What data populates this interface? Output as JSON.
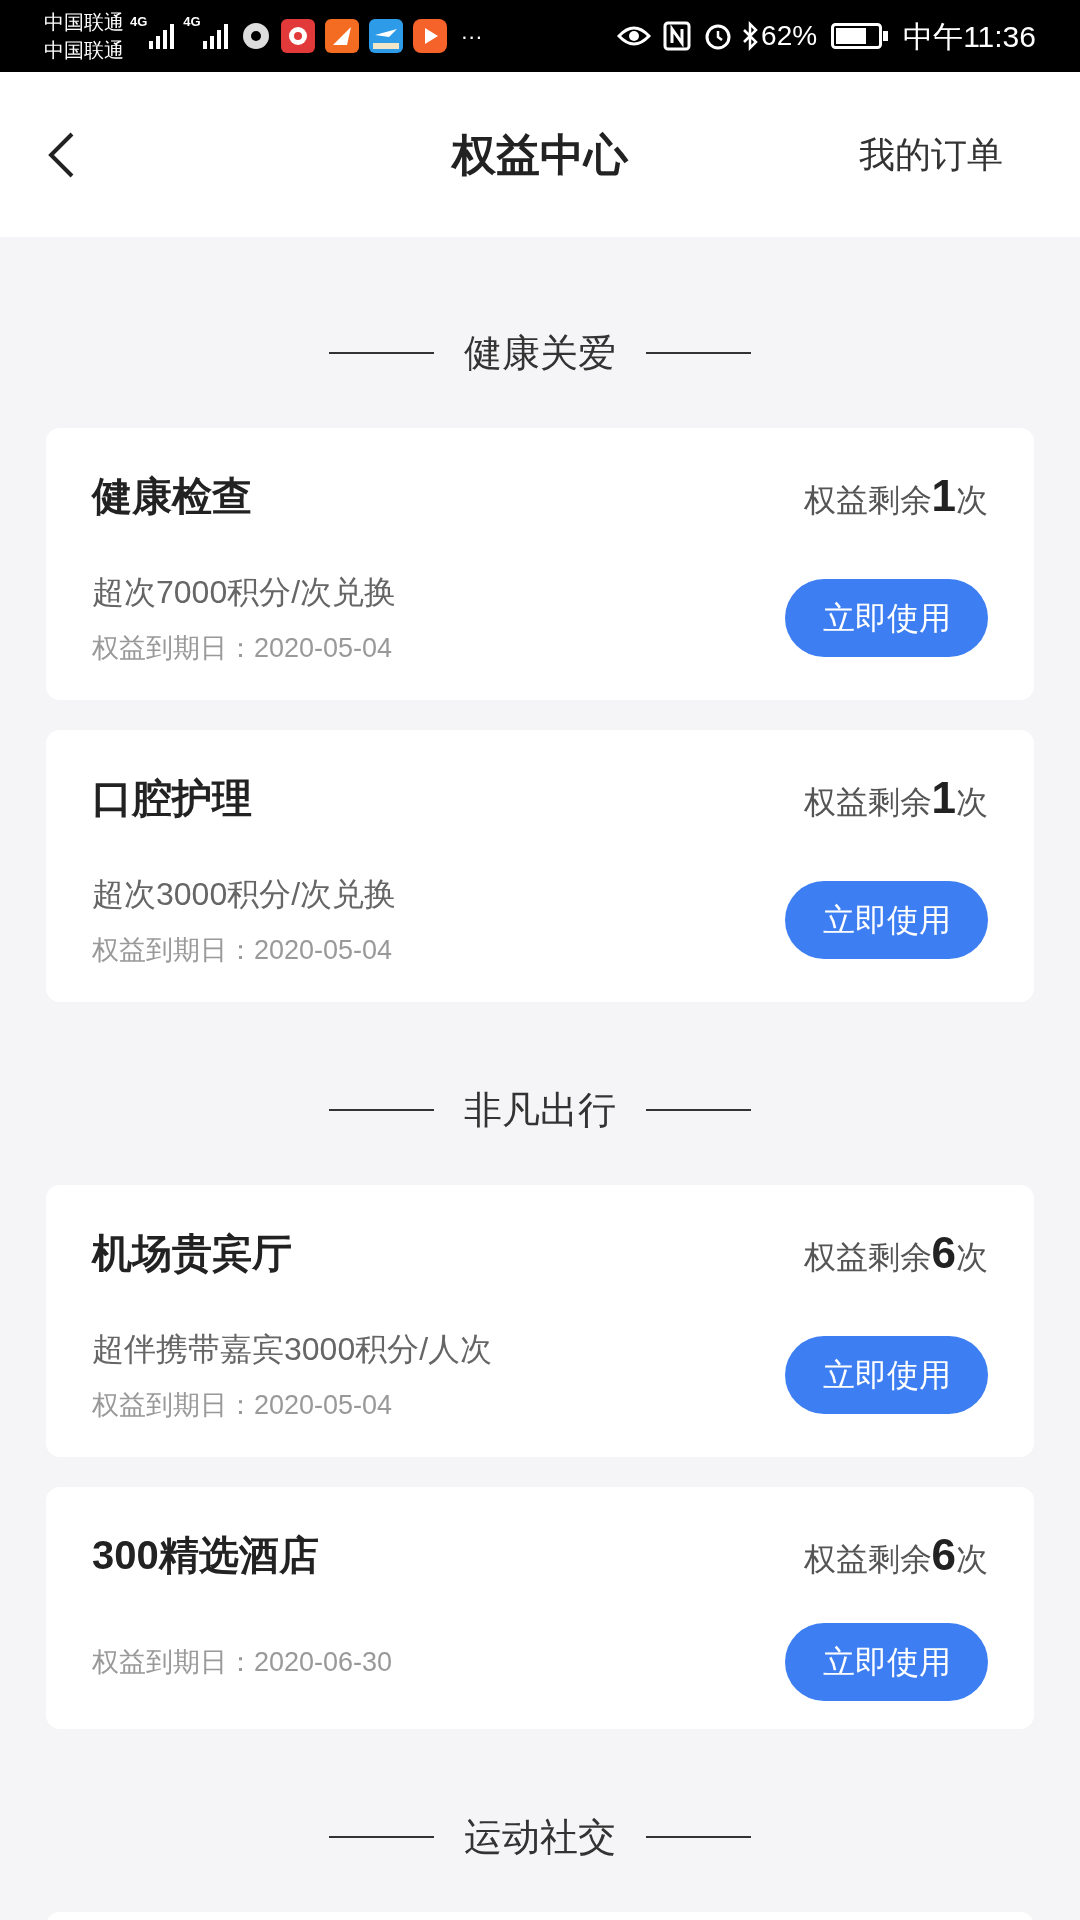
{
  "status_bar": {
    "carriers": [
      "中国联通",
      "中国联通"
    ],
    "networks": [
      "4G",
      "4G"
    ],
    "more": "···",
    "battery": "62%",
    "time": "中午11:36"
  },
  "header": {
    "title": "权益中心",
    "action": "我的订单"
  },
  "sections": [
    {
      "title": "健康关爱",
      "cards": [
        {
          "title": "健康检查",
          "remaining_prefix": "权益剩余",
          "remaining_count": "1",
          "remaining_suffix": "次",
          "description": "超次7000积分/次兑换",
          "expiry": "权益到期日：2020-05-04",
          "button": "立即使用"
        },
        {
          "title": "口腔护理",
          "remaining_prefix": "权益剩余",
          "remaining_count": "1",
          "remaining_suffix": "次",
          "description": "超次3000积分/次兑换",
          "expiry": "权益到期日：2020-05-04",
          "button": "立即使用"
        }
      ]
    },
    {
      "title": "非凡出行",
      "cards": [
        {
          "title": "机场贵宾厅",
          "remaining_prefix": "权益剩余",
          "remaining_count": "6",
          "remaining_suffix": "次",
          "description": "超伴携带嘉宾3000积分/人次",
          "expiry": "权益到期日：2020-05-04",
          "button": "立即使用"
        },
        {
          "title": "300精选酒店",
          "remaining_prefix": "权益剩余",
          "remaining_count": "6",
          "remaining_suffix": "次",
          "expiry": "权益到期日：2020-06-30",
          "button": "立即使用"
        }
      ]
    },
    {
      "title": "运动社交"
    }
  ]
}
